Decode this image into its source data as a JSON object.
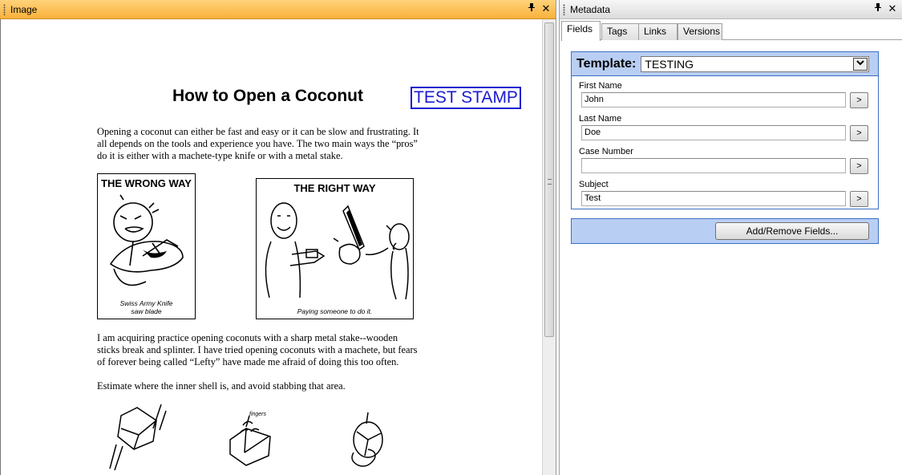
{
  "image_pane": {
    "title": "Image",
    "pin_icon": "pin-icon",
    "close_icon": "close-icon",
    "document": {
      "title": "How to Open a Coconut",
      "stamp": "TEST STAMP",
      "intro_lines": [
        "Opening a coconut can either be fast and easy or it can be slow and frustrating.  It",
        "all depends on the tools and experience you have.  The two main ways the “pros”",
        "do it is either with a machete-type knife or with a metal stake."
      ],
      "wrong_way": {
        "title": "THE WRONG WAY",
        "caption_line1": "Swiss Army Knife",
        "caption_line2": "saw blade"
      },
      "right_way": {
        "title": "THE RIGHT WAY",
        "caption": "Paying someone to do it."
      },
      "practice_lines": [
        "I am acquiring practice opening coconuts with a sharp metal stake--wooden",
        "sticks break and splinter.  I have tried opening coconuts with a machete, but fears",
        "of forever being called “Lefty” have made me afraid of doing this too often."
      ],
      "estimate_line": "Estimate where the inner shell is, and avoid stabbing that area.",
      "sketch_label": "fingers"
    }
  },
  "metadata_pane": {
    "title": "Metadata",
    "tabs": [
      "Fields",
      "Tags",
      "Links",
      "Versions"
    ],
    "active_tab": "Fields",
    "template": {
      "label": "Template:",
      "value": "TESTING"
    },
    "fields": [
      {
        "label": "First Name",
        "value": "John",
        "button": ">"
      },
      {
        "label": "Last Name",
        "value": "Doe",
        "button": ">"
      },
      {
        "label": "Case Number",
        "value": "",
        "button": ">"
      },
      {
        "label": "Subject",
        "value": "Test",
        "button": ">"
      }
    ],
    "add_remove_button": "Add/Remove Fields...",
    "colors": {
      "image_header": "#f9b13b",
      "template_panel": "#b9cef3",
      "template_border": "#3b6fc4",
      "stamp": "#1a1ad0"
    }
  }
}
